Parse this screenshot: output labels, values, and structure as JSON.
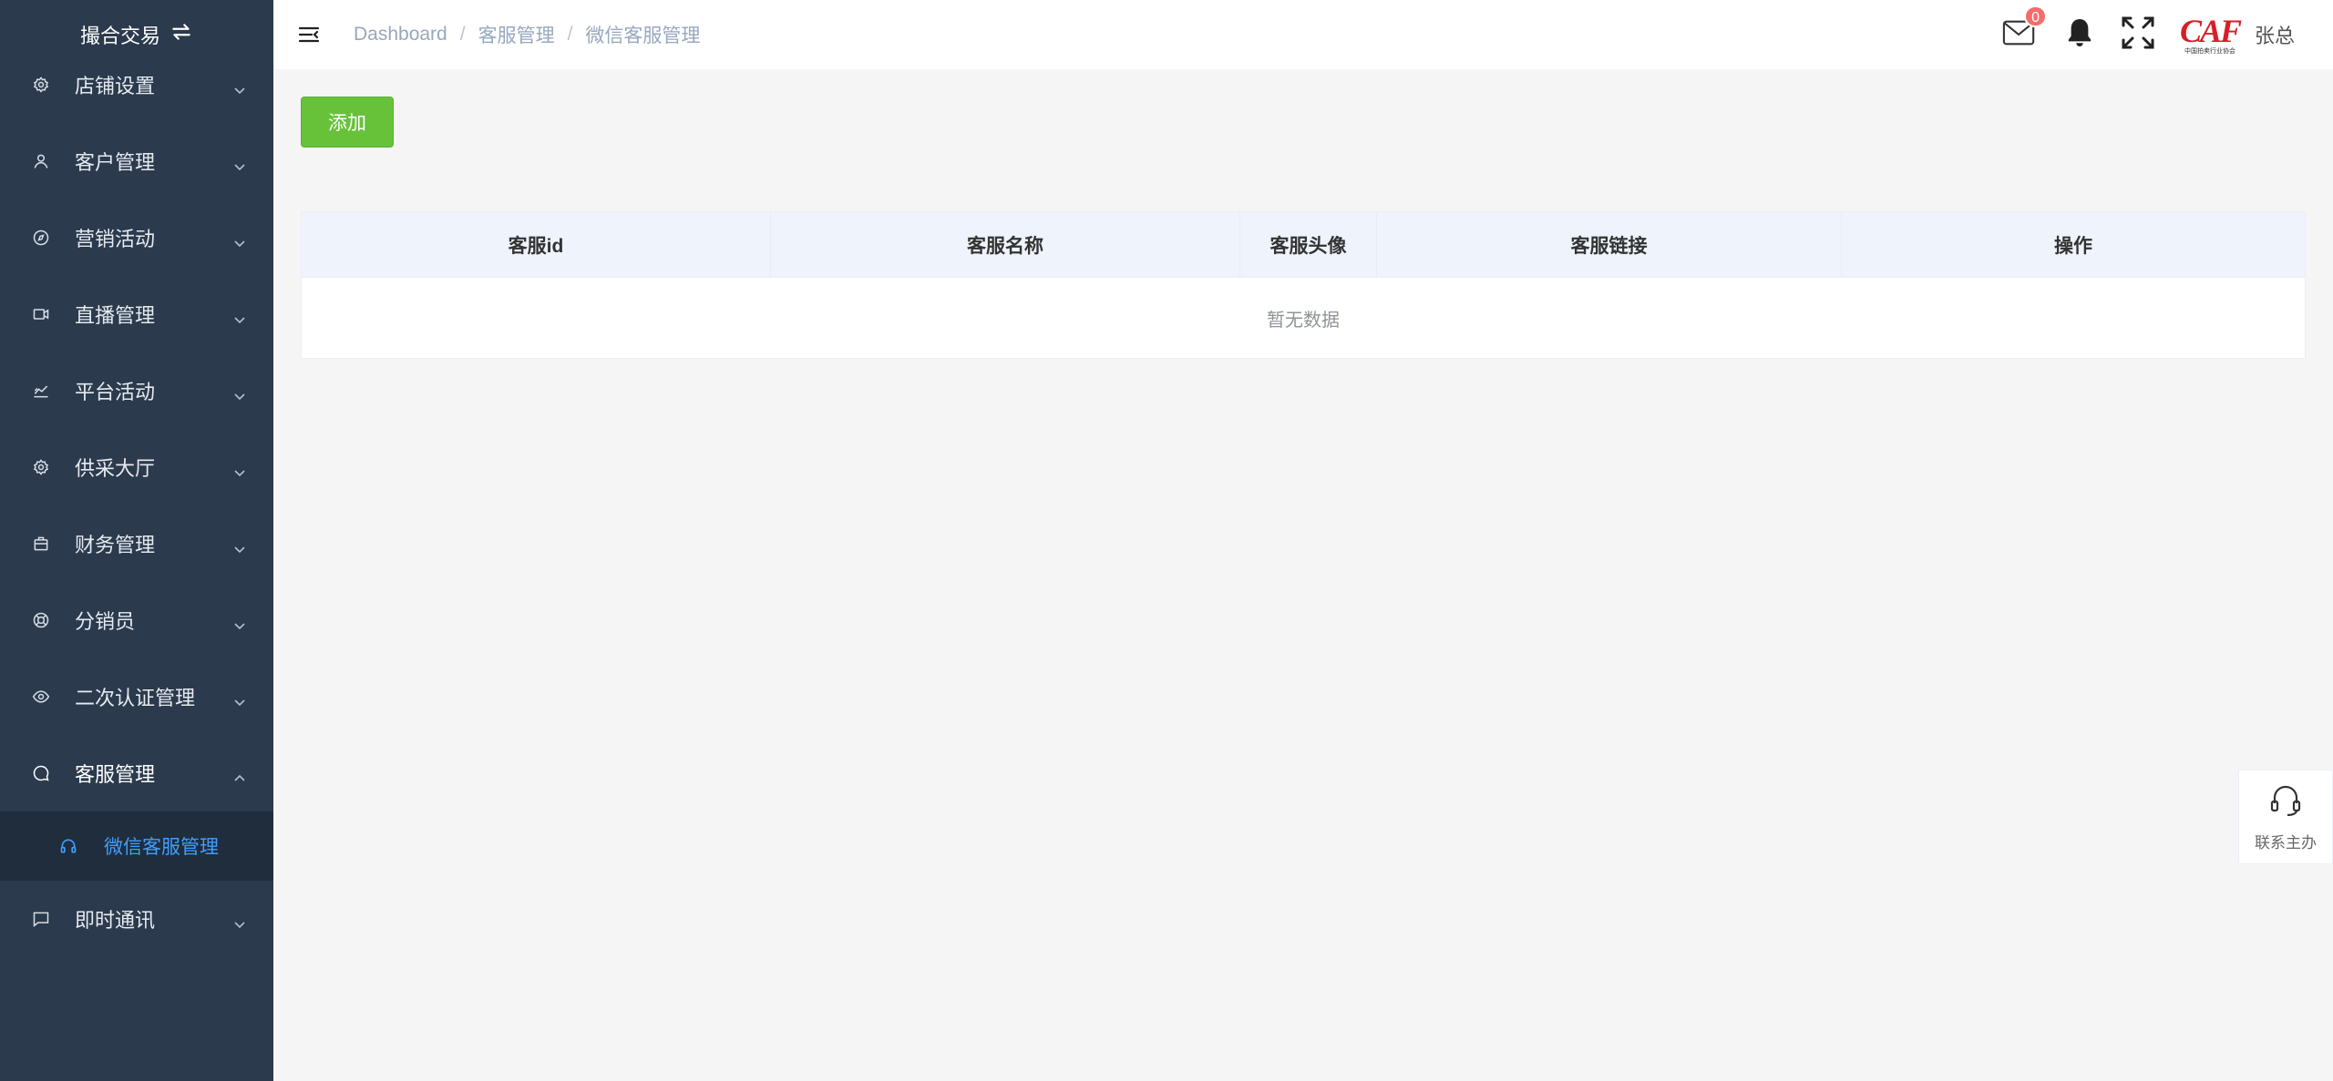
{
  "sidebar": {
    "brand": "撮合交易",
    "items": [
      {
        "label": "店铺设置",
        "icon": "gear-icon"
      },
      {
        "label": "客户管理",
        "icon": "user-icon"
      },
      {
        "label": "营销活动",
        "icon": "compass-icon"
      },
      {
        "label": "直播管理",
        "icon": "video-camera-icon"
      },
      {
        "label": "平台活动",
        "icon": "chart-icon"
      },
      {
        "label": "供采大厅",
        "icon": "gear-icon"
      },
      {
        "label": "财务管理",
        "icon": "briefcase-icon"
      },
      {
        "label": "分销员",
        "icon": "lifebuoy-icon"
      },
      {
        "label": "二次认证管理",
        "icon": "eye-icon"
      },
      {
        "label": "客服管理",
        "icon": "chat-bubble-icon"
      },
      {
        "label": "即时通讯",
        "icon": "message-icon"
      }
    ],
    "sub_item": {
      "label": "微信客服管理",
      "icon": "headset-icon"
    }
  },
  "header": {
    "breadcrumb": [
      "Dashboard",
      "客服管理",
      "微信客服管理"
    ],
    "breadcrumb_sep": "/",
    "mail_badge": "0",
    "logo_text": "CAF",
    "logo_sub": "中国拍卖行业协会",
    "username": "张总"
  },
  "main": {
    "add_label": "添加",
    "columns": [
      "客服id",
      "客服名称",
      "客服头像",
      "客服链接",
      "操作"
    ],
    "empty_text": "暂无数据"
  },
  "float": {
    "label": "联系主办"
  },
  "colors": {
    "sidebar_bg": "#2b3a4d",
    "submenu_bg": "#1f2d3d",
    "accent": "#409eff",
    "success": "#67c23a",
    "badge": "#f56c6c"
  }
}
